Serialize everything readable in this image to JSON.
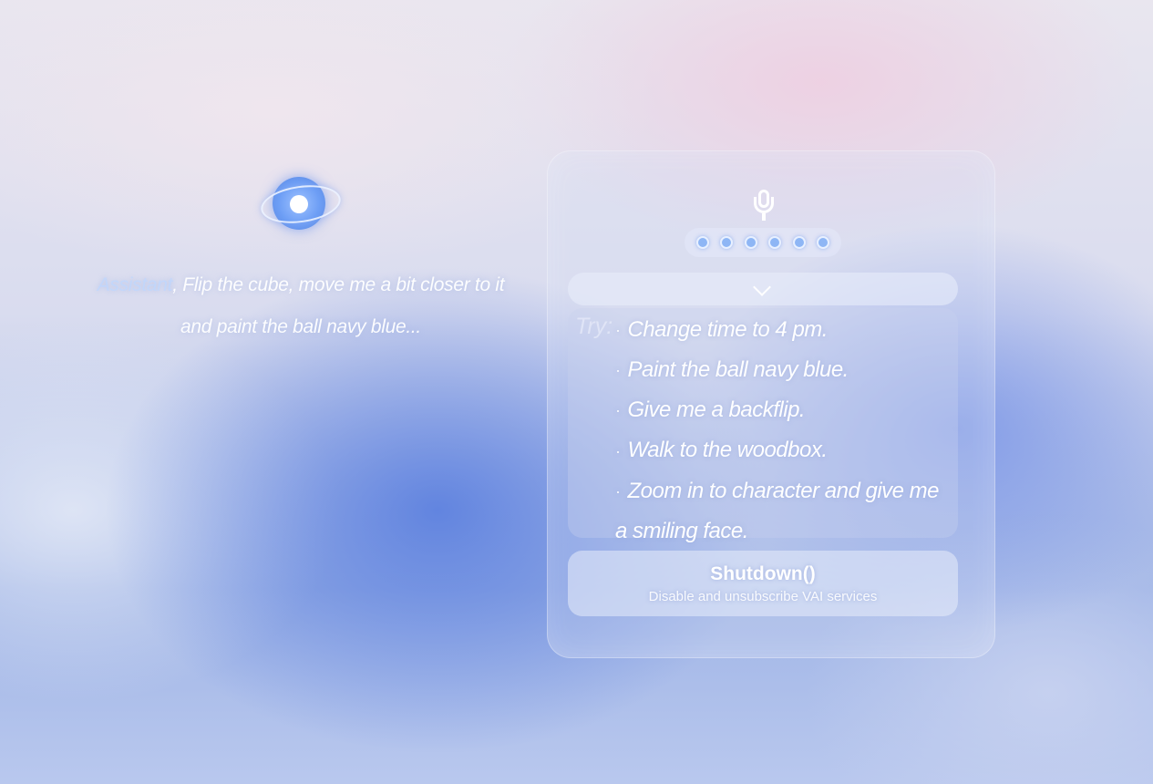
{
  "assistant": {
    "icon": "assistant-orb-icon",
    "wake_word": "Assistant",
    "utterance": ", Flip the cube, move me a bit closer to it and paint the ball navy blue..."
  },
  "panel": {
    "mic_icon": "microphone-icon",
    "listening_dots": 6,
    "collapse_icon": "chevron-down-icon",
    "try_label": "Try:",
    "bullet": "·",
    "suggestions": [
      "Change time to 4 pm.",
      "Paint the ball navy blue.",
      "Give me a backflip.",
      "Walk to the woodbox.",
      "Zoom in to character and give me a smiling face."
    ],
    "shutdown": {
      "title": "Shutdown()",
      "subtitle": "Disable and unsubscribe VAI services"
    }
  },
  "colors": {
    "accent_blue": "#6d9ef5",
    "dot_blue": "#8eb6f5",
    "text": "#ffffff"
  }
}
